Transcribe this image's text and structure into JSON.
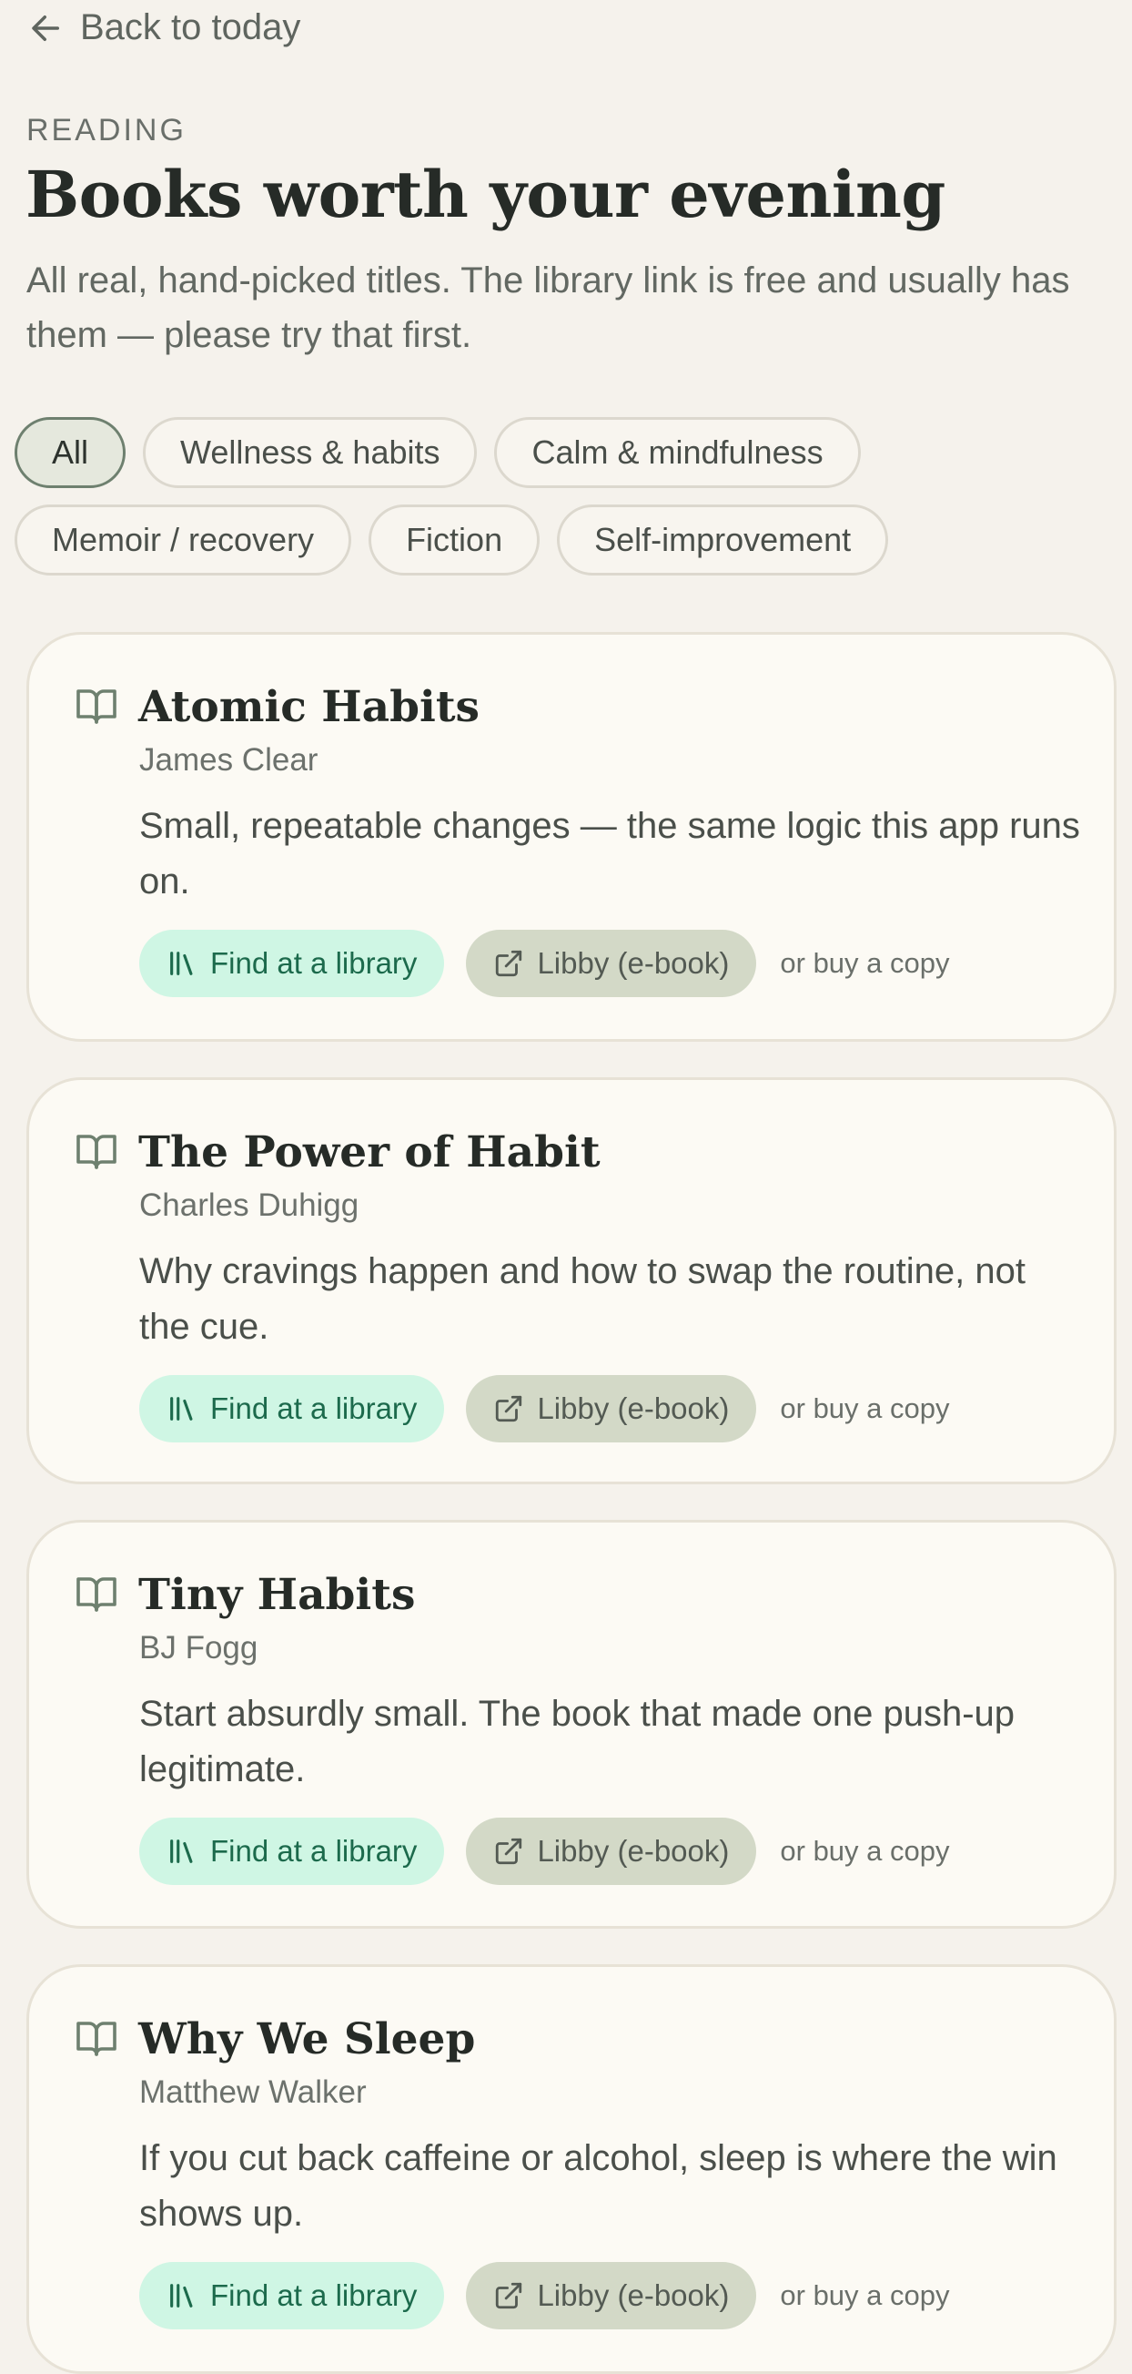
{
  "header": {
    "back_label": "Back to today",
    "eyebrow": "READING",
    "title": "Books worth your evening",
    "subtitle": "All real, hand-picked titles. The library link is free and usually has them — please try that first."
  },
  "filters": [
    {
      "label": "All",
      "active": true
    },
    {
      "label": "Wellness & habits",
      "active": false
    },
    {
      "label": "Calm & mindfulness",
      "active": false
    },
    {
      "label": "Memoir / recovery",
      "active": false
    },
    {
      "label": "Fiction",
      "active": false
    },
    {
      "label": "Self-improvement",
      "active": false
    }
  ],
  "actions": {
    "library_label": "Find at a library",
    "libby_label": "Libby (e-book)",
    "buy_label": "or buy a copy"
  },
  "books": [
    {
      "title": "Atomic Habits",
      "author": "James Clear",
      "description": "Small, repeatable changes — the same logic this app runs on."
    },
    {
      "title": "The Power of Habit",
      "author": "Charles Duhigg",
      "description": "Why cravings happen and how to swap the routine, not the cue."
    },
    {
      "title": "Tiny Habits",
      "author": "BJ Fogg",
      "description": "Start absurdly small. The book that made one push-up legitimate."
    },
    {
      "title": "Why We Sleep",
      "author": "Matthew Walker",
      "description": "If you cut back caffeine or alcohol, sleep is where the win shows up."
    }
  ],
  "colors": {
    "background": "#f5f2ec",
    "card": "#fcfaf4",
    "library_button": "#cff6e4",
    "libby_button": "#d3d9c7",
    "active_chip_border": "#6e806f"
  },
  "icons": {
    "back": "arrow-left-icon",
    "book": "open-book-icon",
    "library": "library-shelf-icon",
    "external": "external-link-icon"
  }
}
